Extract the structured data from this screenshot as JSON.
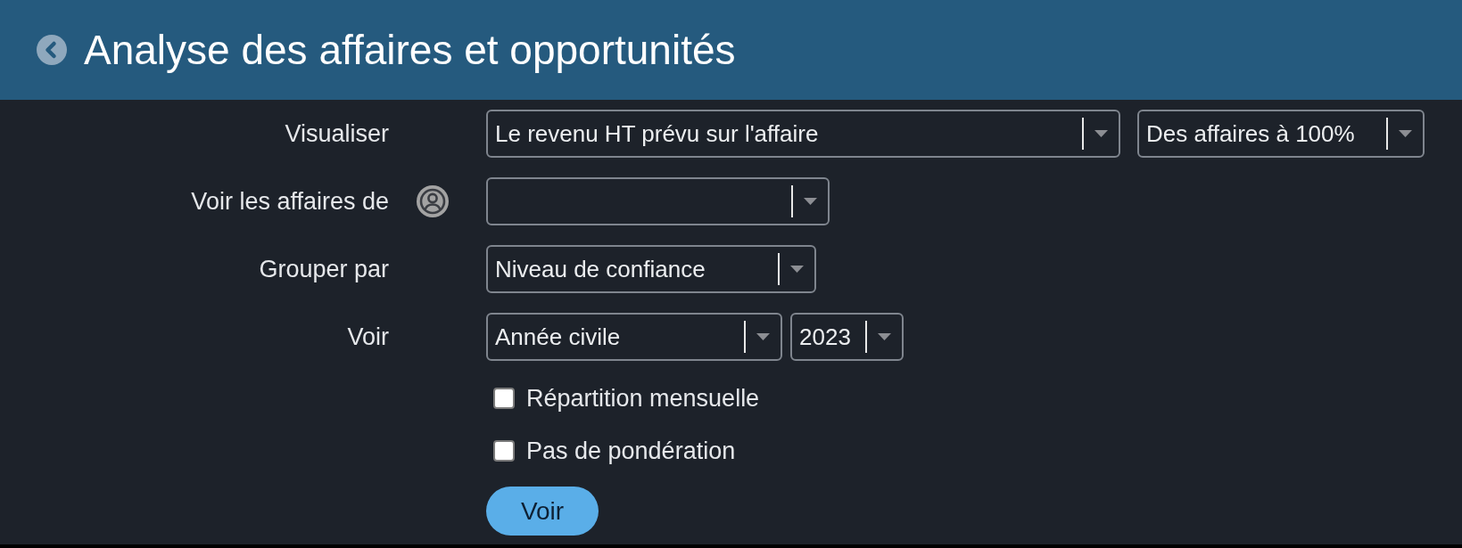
{
  "header": {
    "title": "Analyse des affaires et opportunités"
  },
  "form": {
    "rows": [
      {
        "label": "Visualiser",
        "kind": "select",
        "dropdowns": [
          {
            "value": "Le revenu HT prévu sur l'affaire"
          },
          {
            "value": "Des affaires à 100%"
          }
        ]
      },
      {
        "label": "Voir les affaires de",
        "kind": "user"
      },
      {
        "label": "Grouper par",
        "kind": "select",
        "dropdowns": [
          {
            "value": "Niveau de confiance"
          }
        ]
      },
      {
        "label": "Voir",
        "kind": "select",
        "dropdowns": [
          {
            "value": "Année civile"
          },
          {
            "value": "2023"
          }
        ]
      }
    ],
    "checkboxes": [
      {
        "label": "Répartition mensuelle",
        "checked": false
      },
      {
        "label": "Pas de pondération",
        "checked": false
      }
    ],
    "submit": {
      "label": "Voir"
    }
  }
}
